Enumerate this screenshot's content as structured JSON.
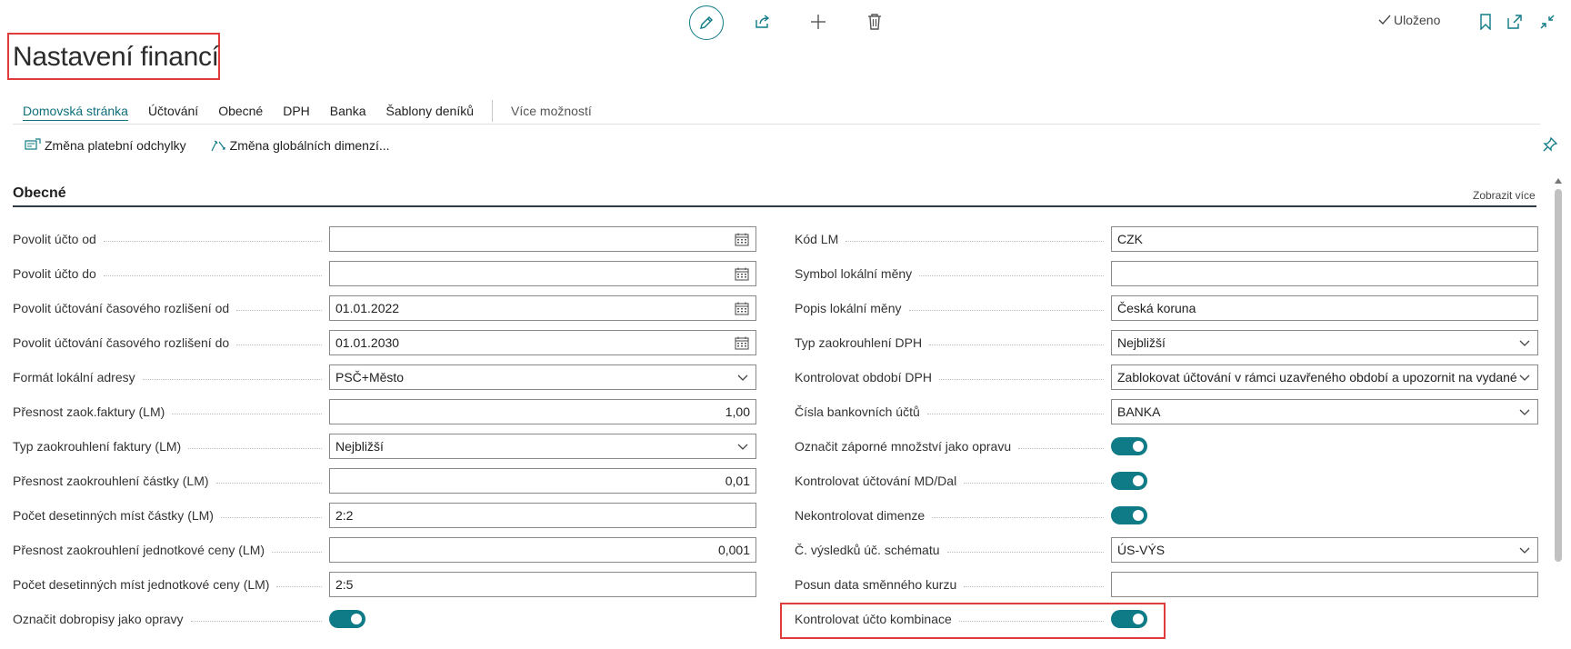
{
  "header": {
    "title": "Nastavení financí",
    "saved_label": "Uloženo",
    "icons": [
      "edit-icon",
      "share-icon",
      "plus-icon",
      "trash-icon",
      "checkmark-icon",
      "bookmark-icon",
      "open-new-window-icon",
      "collapse-icon"
    ]
  },
  "menu": {
    "items": [
      "Domovská stránka",
      "Účtování",
      "Obecné",
      "DPH",
      "Banka",
      "Šablony deníků"
    ],
    "more": "Více možností"
  },
  "actions": {
    "items": [
      "Změna platební odchylky",
      "Změna globálních dimenzí..."
    ]
  },
  "section": {
    "title": "Obecné",
    "show_more": "Zobrazit více"
  },
  "left_fields": [
    {
      "label": "Povolit účto od",
      "value": "",
      "type": "date"
    },
    {
      "label": "Povolit účto do",
      "value": "",
      "type": "date"
    },
    {
      "label": "Povolit účtování časového rozlišení od",
      "value": "01.01.2022",
      "type": "date"
    },
    {
      "label": "Povolit účtování časového rozlišení do",
      "value": "01.01.2030",
      "type": "date"
    },
    {
      "label": "Formát lokální adresy",
      "value": "PSČ+Město",
      "type": "select"
    },
    {
      "label": "Přesnost zaok.faktury (LM)",
      "value": "1,00",
      "type": "number"
    },
    {
      "label": "Typ zaokrouhlení faktury (LM)",
      "value": "Nejbližší",
      "type": "select"
    },
    {
      "label": "Přesnost zaokrouhlení částky (LM)",
      "value": "0,01",
      "type": "number"
    },
    {
      "label": "Počet desetinných míst částky (LM)",
      "value": "2:2",
      "type": "text"
    },
    {
      "label": "Přesnost zaokrouhlení jednotkové ceny (LM)",
      "value": "0,001",
      "type": "number"
    },
    {
      "label": "Počet desetinných míst jednotkové ceny (LM)",
      "value": "2:5",
      "type": "text"
    },
    {
      "label": "Označit dobropisy jako opravy",
      "value": "on",
      "type": "toggle"
    }
  ],
  "right_fields": [
    {
      "label": "Kód LM",
      "value": "CZK",
      "type": "text"
    },
    {
      "label": "Symbol lokální měny",
      "value": "",
      "type": "text"
    },
    {
      "label": "Popis lokální měny",
      "value": "Česká koruna",
      "type": "text"
    },
    {
      "label": "Typ zaokrouhlení DPH",
      "value": "Nejbližší",
      "type": "select"
    },
    {
      "label": "Kontrolovat období DPH",
      "value": "Zablokovat účtování v rámci uzavřeného období a upozornit na vydané",
      "type": "select"
    },
    {
      "label": "Čísla bankovních účtů",
      "value": "BANKA",
      "type": "select"
    },
    {
      "label": "Označit záporné množství jako opravu",
      "value": "on",
      "type": "toggle"
    },
    {
      "label": "Kontrolovat účtování MD/Dal",
      "value": "on",
      "type": "toggle"
    },
    {
      "label": "Nekontrolovat dimenze",
      "value": "on",
      "type": "toggle"
    },
    {
      "label": "Č. výsledků úč. schématu",
      "value": "ÚS-VÝS",
      "type": "select"
    },
    {
      "label": "Posun data směnného kurzu",
      "value": "",
      "type": "text"
    },
    {
      "label": "Kontrolovat účto kombinace",
      "value": "on",
      "type": "toggle"
    }
  ],
  "colors": {
    "accent": "#0f7b86",
    "highlight": "#e03c3c"
  }
}
